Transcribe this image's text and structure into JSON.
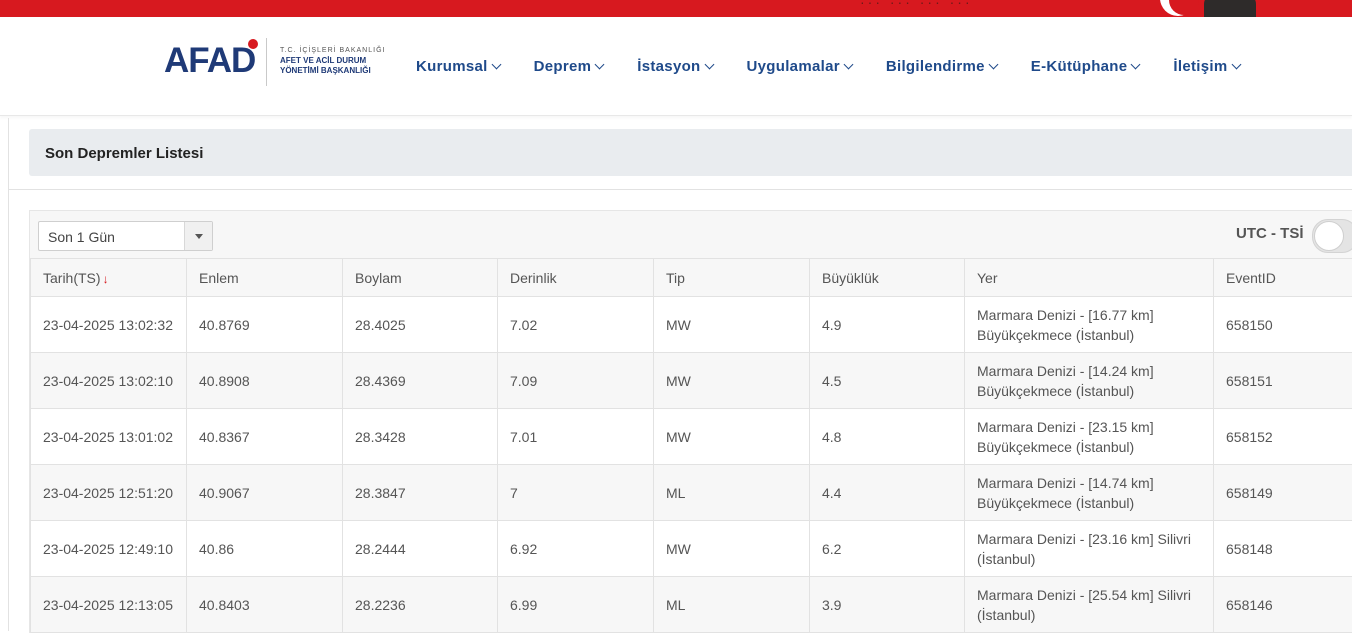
{
  "brand": {
    "logo_text": "AFAD",
    "line1": "T.C. İÇİŞLERİ BAKANLIĞI",
    "line2": "AFET VE ACİL DURUM",
    "line3": "YÖNETİMİ BAŞKANLIĞI",
    "accent_color": "#d7191f",
    "primary_color": "#1f3a77"
  },
  "nav": {
    "items": [
      {
        "label": "Kurumsal"
      },
      {
        "label": "Deprem"
      },
      {
        "label": "İstasyon"
      },
      {
        "label": "Uygulamalar"
      },
      {
        "label": "Bilgilendirme"
      },
      {
        "label": "E-Kütüphane"
      },
      {
        "label": "İletişim"
      }
    ]
  },
  "panel": {
    "title": "Son Depremler Listesi"
  },
  "filter": {
    "selected": "Son 1 Gün"
  },
  "time_mode": {
    "label": "UTC - TSİ"
  },
  "table": {
    "headers": [
      "Tarih(TS)",
      "Enlem",
      "Boylam",
      "Derinlik",
      "Tip",
      "Büyüklük",
      "Yer",
      "EventID"
    ],
    "rows": [
      [
        "23-04-2025 13:02:32",
        "40.8769",
        "28.4025",
        "7.02",
        "MW",
        "4.9",
        "Marmara Denizi - [16.77 km] Büyükçekmece (İstanbul)",
        "658150"
      ],
      [
        "23-04-2025 13:02:10",
        "40.8908",
        "28.4369",
        "7.09",
        "MW",
        "4.5",
        "Marmara Denizi - [14.24 km] Büyükçekmece (İstanbul)",
        "658151"
      ],
      [
        "23-04-2025 13:01:02",
        "40.8367",
        "28.3428",
        "7.01",
        "MW",
        "4.8",
        "Marmara Denizi - [23.15 km] Büyükçekmece (İstanbul)",
        "658152"
      ],
      [
        "23-04-2025 12:51:20",
        "40.9067",
        "28.3847",
        "7",
        "ML",
        "4.4",
        "Marmara Denizi - [14.74 km] Büyükçekmece (İstanbul)",
        "658149"
      ],
      [
        "23-04-2025 12:49:10",
        "40.86",
        "28.2444",
        "6.92",
        "MW",
        "6.2",
        "Marmara Denizi - [23.16 km] Silivri (İstanbul)",
        "658148"
      ],
      [
        "23-04-2025 12:13:05",
        "40.8403",
        "28.2236",
        "6.99",
        "ML",
        "3.9",
        "Marmara Denizi - [25.54 km] Silivri (İstanbul)",
        "658146"
      ]
    ]
  }
}
